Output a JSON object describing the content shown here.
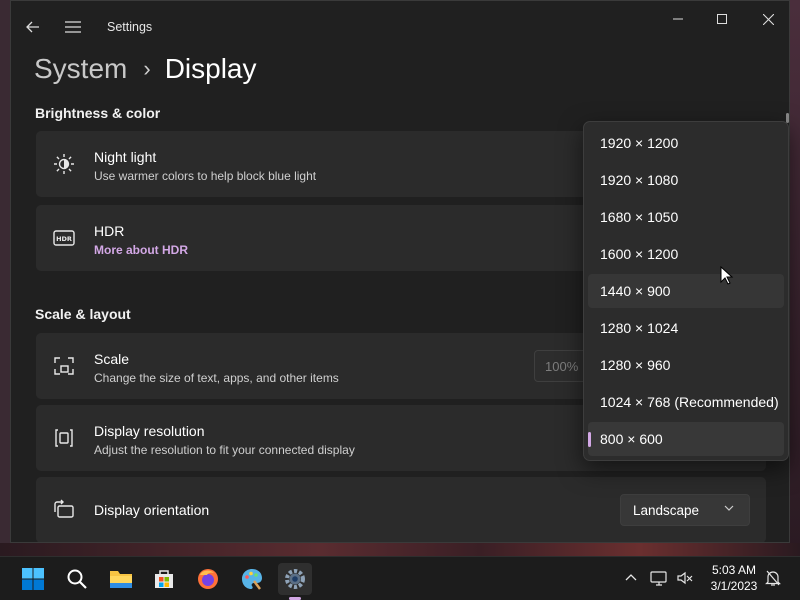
{
  "window": {
    "app_title": "Settings"
  },
  "breadcrumb": {
    "parent": "System",
    "current": "Display"
  },
  "sections": {
    "brightness_color": "Brightness & color",
    "scale_layout": "Scale & layout"
  },
  "cards": {
    "night_light": {
      "title": "Night light",
      "subtitle": "Use warmer colors to help block blue light",
      "icon": "brightness-icon"
    },
    "hdr": {
      "title": "HDR",
      "link": "More about HDR",
      "icon": "hdr-icon"
    },
    "scale": {
      "title": "Scale",
      "subtitle": "Change the size of text, apps, and other items",
      "value": "100%",
      "icon": "scale-icon"
    },
    "resolution": {
      "title": "Display resolution",
      "subtitle": "Adjust the resolution to fit your connected display",
      "icon": "resolution-icon"
    },
    "orientation": {
      "title": "Display orientation",
      "value": "Landscape",
      "icon": "rotate-icon"
    }
  },
  "resolution_dropdown": {
    "options": [
      "1920 × 1200",
      "1920 × 1080",
      "1680 × 1050",
      "1600 × 1200",
      "1440 × 900",
      "1280 × 1024",
      "1280 × 960",
      "1024 × 768 (Recommended)",
      "800 × 600"
    ],
    "hovered_option": "1440 × 900",
    "selected_option": "800 × 600"
  },
  "taskbar": {
    "apps": [
      "windows-start-icon",
      "search-icon",
      "file-explorer-icon",
      "microsoft-store-icon",
      "firefox-icon",
      "paint-icon",
      "settings-icon"
    ],
    "active_app": "settings-icon",
    "time": "5:03 AM",
    "date": "3/1/2023"
  },
  "colors": {
    "accent": "#d3a8e6",
    "window_bg": "#202020",
    "card_bg": "#2b2b2b",
    "flyout_bg": "#2c2c2c",
    "taskbar_bg": "#1c1c1c"
  }
}
